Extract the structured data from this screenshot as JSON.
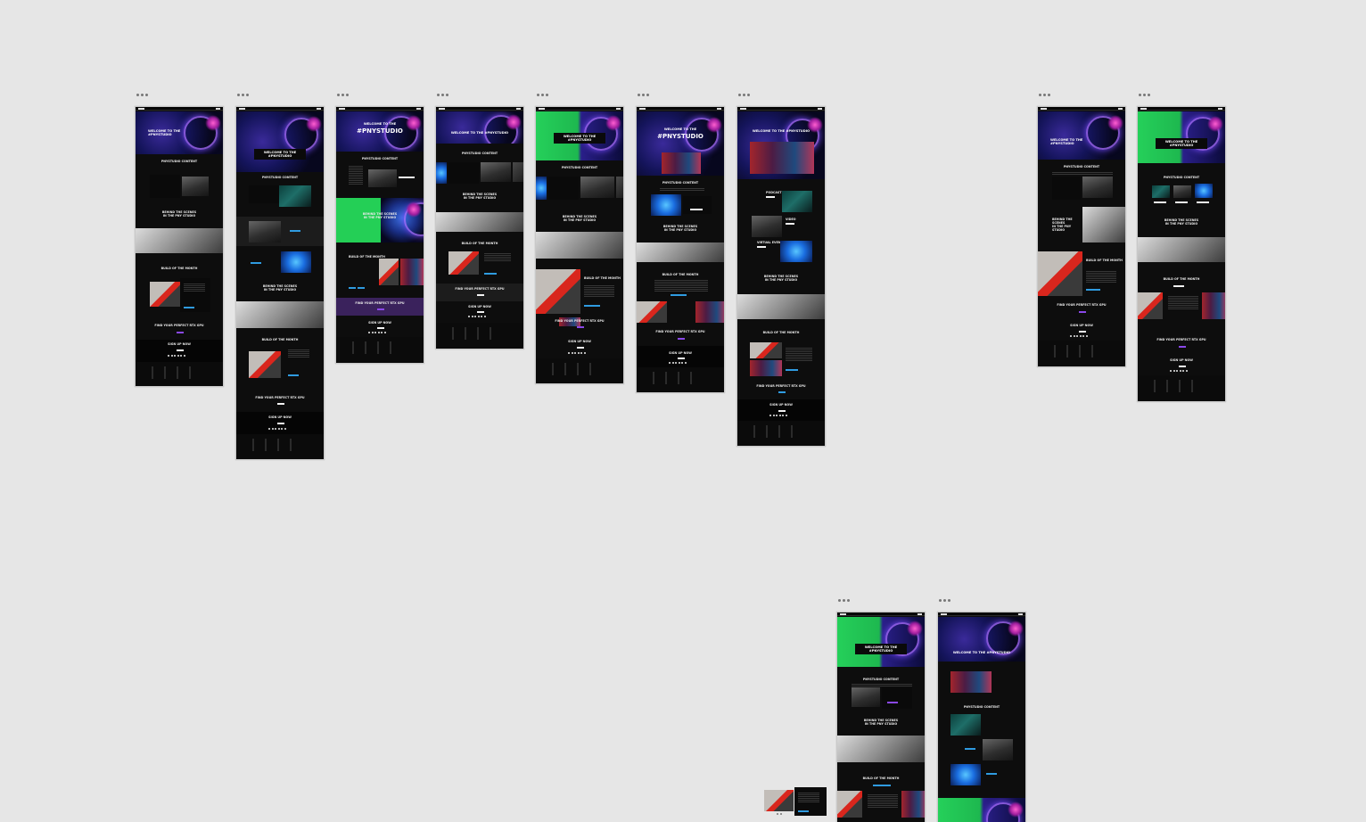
{
  "app": {
    "view": "Artboard overview canvas"
  },
  "artboard_menu_icon": "more-dots-icon",
  "copy": {
    "welcome_line1": "WELCOME TO THE",
    "welcome_line2": "#PNYSTUDIO",
    "welcome_inline": "WELCOME TO THE #PNYSTUDIO",
    "pnystudio_big": "#PNYSTUDIO",
    "pnystudio_content": "PNYSTUDIO CONTENT",
    "behind_l1": "BEHIND THE SCENES",
    "behind_l2": "IN THE PNY STUDIO",
    "build_of_month": "BUILD OF THE MONTH",
    "find_gpu": "FIND YOUR PERFECT RTX GPU",
    "sign_up": "SIGN UP NOW",
    "podcast": "PODCAST",
    "video": "VIDEO",
    "virtual_event": "VIRTUAL EVENT"
  },
  "colors": {
    "canvas": "#e6e6e6",
    "page_bg": "#0d0d0d",
    "accent_blue": "#2f9be0",
    "accent_green": "#24cf56",
    "accent_purple": "#8a48e8",
    "brand_red": "#d9261d"
  }
}
